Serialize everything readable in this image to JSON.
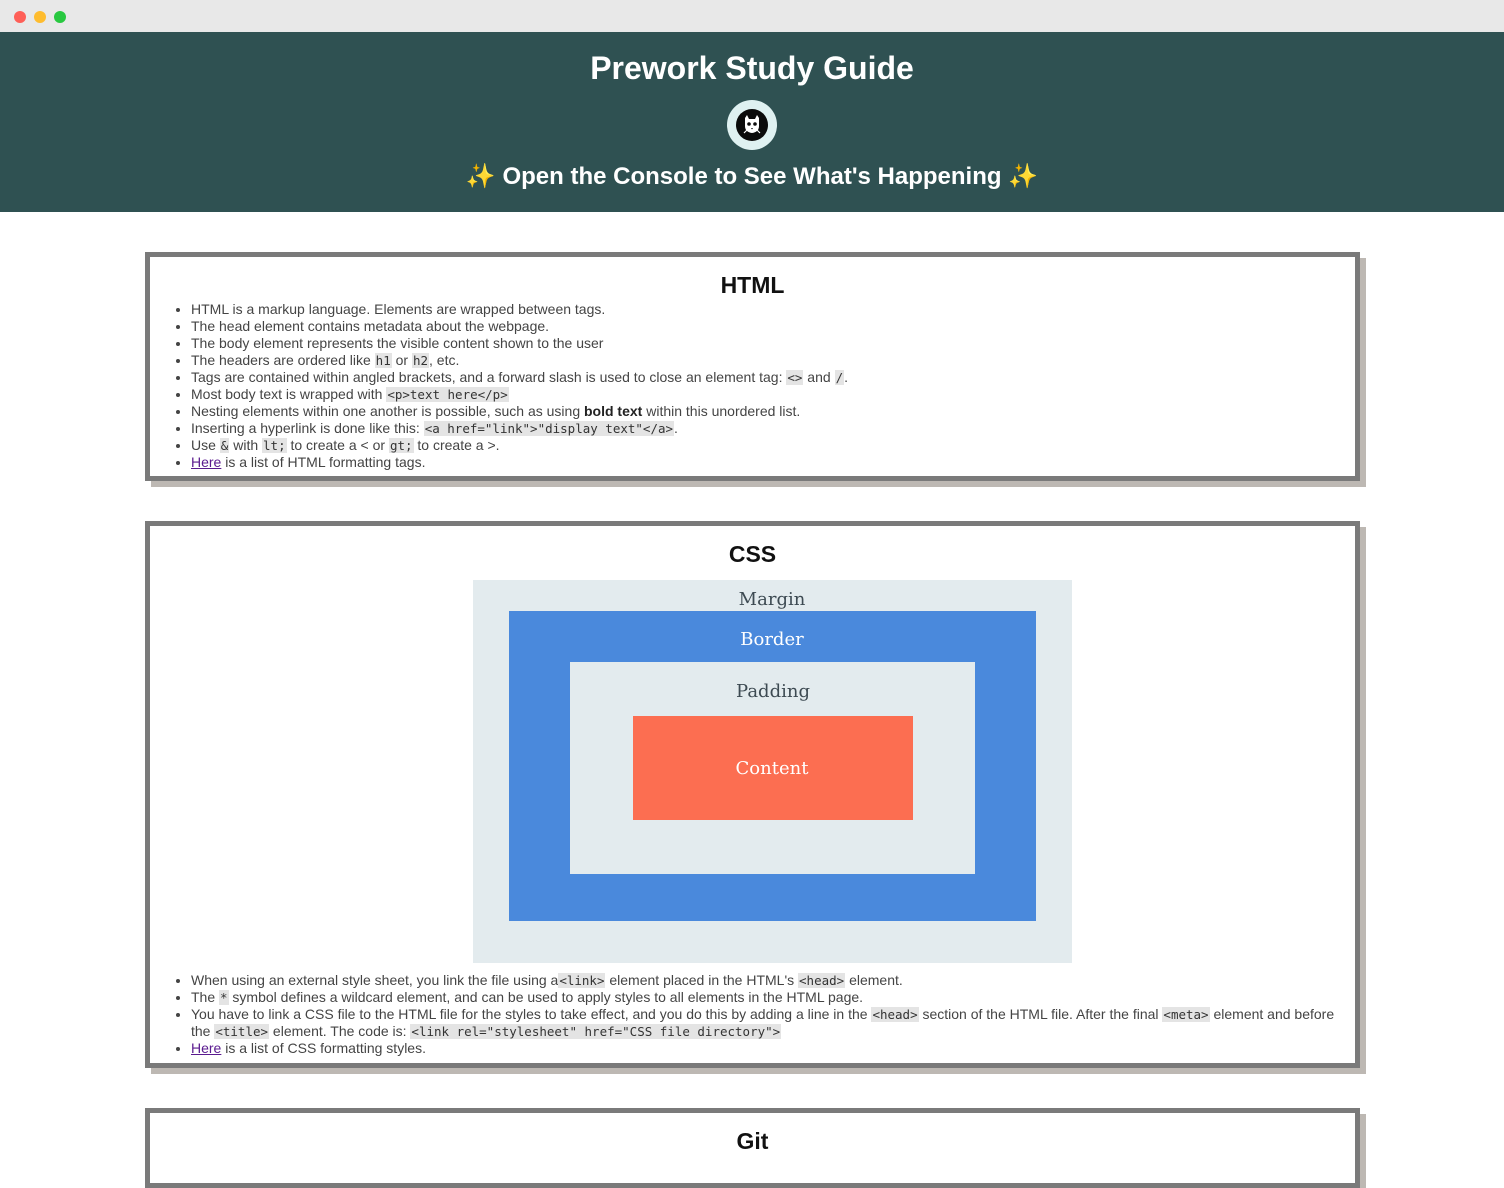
{
  "window": {
    "controls": [
      "close",
      "minimize",
      "maximize"
    ]
  },
  "header": {
    "title": "Prework Study Guide",
    "subtitle_sparkle": "✨",
    "subtitle": "Open the Console to See What's Happening",
    "avatar_icon": "cat-skull-icon",
    "background": "#2f5152"
  },
  "html_section": {
    "title": "HTML",
    "items": [
      {
        "text": "HTML is a markup language. Elements are wrapped between tags."
      },
      {
        "text": "The head element contains metadata about the webpage."
      },
      {
        "text": "The body element represents the visible content shown to the user"
      },
      {
        "pre": "The headers are ordered like ",
        "code1": "h1",
        "mid": " or ",
        "code2": "h2",
        "post": ", etc."
      },
      {
        "pre": "Tags are contained within angled brackets, and a forward slash is used to close an element tag: ",
        "code1": "<>",
        "mid": " and ",
        "code2": "/",
        "post": "."
      },
      {
        "pre": "Most body text is wrapped with ",
        "code1": "<p>text here</p>"
      },
      {
        "pre": "Nesting elements within one another is possible, such as using ",
        "bold": "bold text",
        "post": " within this unordered list."
      },
      {
        "pre": "Inserting a hyperlink is done like this: ",
        "code1": "<a href=\"link\">\"display text\"</a>",
        "post": "."
      },
      {
        "pre": "Use ",
        "code1": "&",
        "mid": " with ",
        "code2": "lt;",
        "mid2": " to create a < or ",
        "code3": "gt;",
        "post": " to create a >."
      },
      {
        "link": "Here",
        "post": " is a list of HTML formatting tags."
      }
    ]
  },
  "css_section": {
    "title": "CSS",
    "diagram": {
      "margin_label": "Margin",
      "border_label": "Border",
      "padding_label": "Padding",
      "content_label": "Content",
      "margin_color": "#e3ebee",
      "border_color": "#4a89dc",
      "padding_color": "#e3ebee",
      "content_color": "#fc6e51"
    },
    "items": [
      {
        "pre": "When using an external style sheet, you link the file using a",
        "code1": "<link>",
        "mid": " element placed in the HTML's ",
        "code2": "<head>",
        "post": " element."
      },
      {
        "pre": "The ",
        "code1": "*",
        "post": " symbol defines a wildcard element, and can be used to apply styles to all elements in the HTML page."
      },
      {
        "pre": "You have to link a CSS file to the HTML file for the styles to take effect, and you do this by adding a line in the ",
        "code1": "<head>",
        "mid": " section of the HTML file. After the final ",
        "code2": "<meta>",
        "mid2": " element and before the ",
        "code3": "<title>",
        "mid3": " element. The code is: ",
        "code4": "<link rel=\"stylesheet\" href=\"CSS file directory\">"
      },
      {
        "link": "Here",
        "post": " is a list of CSS formatting styles."
      }
    ]
  },
  "git_section": {
    "title": "Git"
  }
}
